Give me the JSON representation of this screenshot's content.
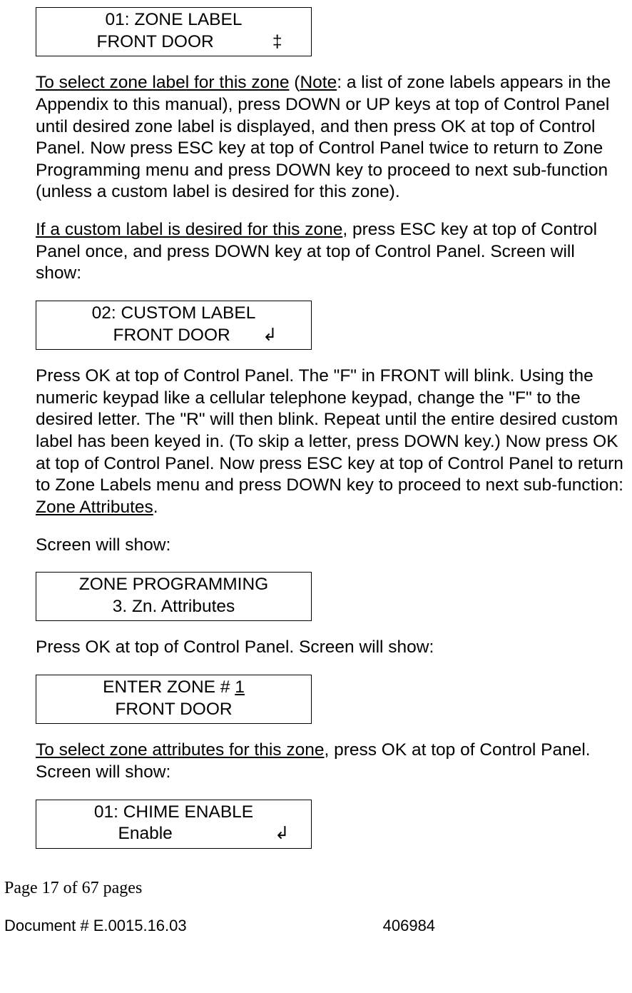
{
  "display1": {
    "line1": "01: ZONE LABEL",
    "line2": "FRONT DOOR",
    "symbol": "‡"
  },
  "para1": {
    "u1": "To select zone label for this zone",
    "t1": " (",
    "u2": "Note",
    "t2": ": a list of zone labels appears in the Appendix to this manual), press DOWN or UP keys at top of Control Panel until desired zone label is displayed, and then press OK at top of Control Panel. Now press ESC key at top of Control Panel twice to return to Zone Programming menu and press DOWN key to proceed to next sub-function (unless a custom label is desired for this zone)."
  },
  "para2": {
    "u1": "If a custom label is desired for this zone",
    "t1": ", press ESC key at top of Control Panel once, and press DOWN key at top of Control Panel. Screen will show:"
  },
  "display2": {
    "line1": "02: CUSTOM LABEL",
    "line2": "FRONT DOOR",
    "symbol": "↲"
  },
  "para3": {
    "t1": "Press OK at top of Control Panel. The \"F\" in FRONT will blink. Using the numeric keypad like a cellular telephone keypad, change the \"F\" to the desired letter. The \"R\" will then blink. Repeat until the entire desired custom label has been keyed in. (To skip a letter, press DOWN key.) Now press OK at top of Control Panel. Now press ESC key at top of Control Panel to return to Zone Labels menu and press DOWN key to proceed to next sub-function: ",
    "u1": "Zone Attributes",
    "t2": "."
  },
  "para4": "Screen will show:",
  "display3": {
    "line1": "ZONE PROGRAMMING",
    "line2": "3. Zn. Attributes"
  },
  "para5": "Press OK at top of Control Panel. Screen will show:",
  "display4": {
    "line1a": "ENTER ZONE # ",
    "line1b": "1",
    "line2": "FRONT DOOR"
  },
  "para6": {
    "u1": "To select zone attributes for this zone",
    "t1": ", press OK at top of Control Panel. Screen will show:"
  },
  "display5": {
    "line1": "01: CHIME ENABLE",
    "line2": "Enable",
    "symbol": "↲"
  },
  "footer": {
    "page": "Page 17 of  67 pages",
    "doc": "Document # E.0015.16.03",
    "num": "406984"
  }
}
